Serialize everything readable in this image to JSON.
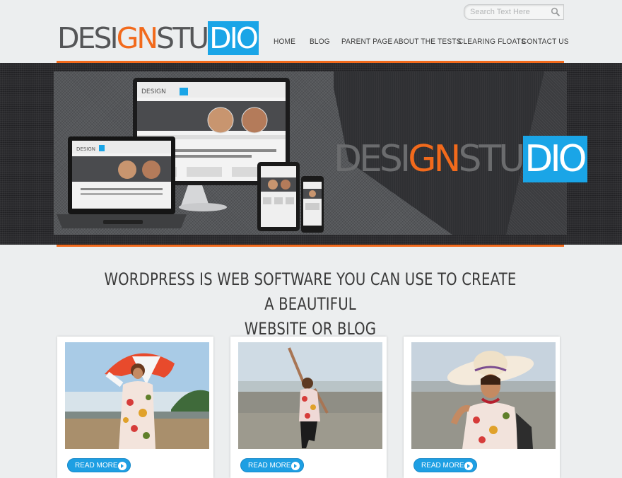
{
  "search": {
    "placeholder": "Search Text Here"
  },
  "logo": {
    "part1": "DESIGN",
    "part2": "G",
    "part3": "STU",
    "part4": "DIO"
  },
  "nav": [
    {
      "label": "HOME"
    },
    {
      "label": "BLOG"
    },
    {
      "label": "PARENT PAGE"
    },
    {
      "label": "ABOUT THE TESTS"
    },
    {
      "label": "CLEARING FLOATS"
    },
    {
      "label": "CONTACT US"
    }
  ],
  "banner": {
    "logo_part1": "DESIGN",
    "logo_part2": "GN",
    "logo_part3": "STU",
    "logo_part4": "DIO"
  },
  "headline": {
    "line1": "WORDPRESS IS WEB SOFTWARE YOU CAN USE TO CREATE A BEAUTIFUL",
    "line2": "WEBSITE OR BLOG"
  },
  "cards": [
    {
      "button": "READ MORE"
    },
    {
      "button": "READ MORE"
    },
    {
      "button": "READ MORE"
    }
  ],
  "colors": {
    "accent": "#f26a1c",
    "blue": "#1aa5e7",
    "text": "#3a3a3a"
  }
}
